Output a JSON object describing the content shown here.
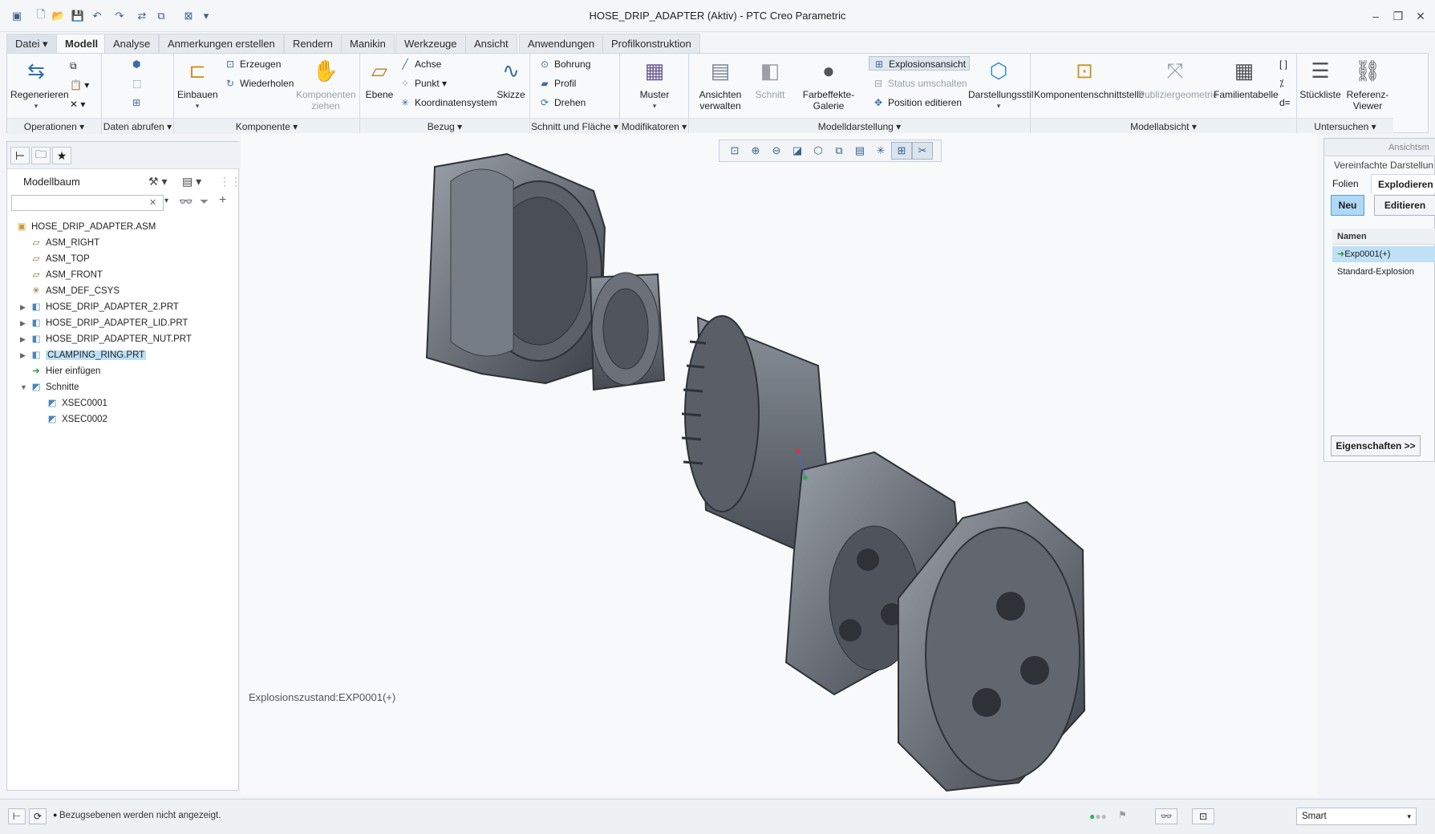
{
  "window": {
    "title": "HOSE_DRIP_ADAPTER (Aktiv) - PTC Creo Parametric"
  },
  "quick_access": {
    "icons": [
      "app-icon",
      "new-icon",
      "open-icon",
      "save-icon",
      "undo-icon",
      "redo-icon",
      "regenerate-icon",
      "windows-icon",
      "close-window-icon",
      "customize-icon"
    ]
  },
  "tabs": [
    "Datei",
    "Modell",
    "Analyse",
    "Anmerkungen erstellen",
    "Rendern",
    "Manikin",
    "Werkzeuge",
    "Ansicht",
    "Anwendungen",
    "Profilkonstruktion"
  ],
  "ribbon": {
    "operationen": {
      "regenerieren": "Regenerieren",
      "group": "Operationen"
    },
    "daten_abrufen": {
      "group": "Daten abrufen"
    },
    "komponente": {
      "einbauen": "Einbauen",
      "erzeugen": "Erzeugen",
      "wiederholen": "Wiederholen",
      "komponenten_ziehen": "Komponenten ziehen",
      "group": "Komponente"
    },
    "bezug": {
      "ebene": "Ebene",
      "achse": "Achse",
      "punkt": "Punkt",
      "koordinatensystem": "Koordinatensystem",
      "skizze": "Skizze",
      "group": "Bezug"
    },
    "schnitt": {
      "bohrung": "Bohrung",
      "profil": "Profil",
      "drehen": "Drehen",
      "group": "Schnitt und Fläche"
    },
    "modifikatoren": {
      "muster": "Muster",
      "group": "Modifikatoren"
    },
    "modelldarstellung": {
      "ansichten_verwalten": "Ansichten verwalten",
      "schnitt": "Schnitt",
      "farbeffekte": "Farbeffekte-Galerie",
      "explosionsansicht": "Explosionsansicht",
      "status_umschalten": "Status umschalten",
      "position_editieren": "Position editieren",
      "darstellungsstil": "Darstellungsstil",
      "group": "Modelldarstellung"
    },
    "modellabsicht": {
      "komponentenschnittstelle": "Komponentenschnittstelle",
      "publiziergeometrie": "Publiziergeometrie",
      "familientabelle": "Familientabelle",
      "group": "Modellabsicht"
    },
    "untersuchen": {
      "stueckliste": "Stückliste",
      "referenz_viewer": "Referenz-Viewer",
      "group": "Untersuchen"
    }
  },
  "model_tree": {
    "title": "Modellbaum",
    "search_placeholder": "",
    "items": [
      {
        "label": "HOSE_DRIP_ADAPTER.ASM",
        "icon": "assembly-icon"
      },
      {
        "label": "ASM_RIGHT",
        "icon": "datum-plane-icon"
      },
      {
        "label": "ASM_TOP",
        "icon": "datum-plane-icon"
      },
      {
        "label": "ASM_FRONT",
        "icon": "datum-plane-icon"
      },
      {
        "label": "ASM_DEF_CSYS",
        "icon": "csys-icon"
      },
      {
        "label": "HOSE_DRIP_ADAPTER_2.PRT",
        "icon": "part-icon"
      },
      {
        "label": "HOSE_DRIP_ADAPTER_LID.PRT",
        "icon": "part-icon"
      },
      {
        "label": "HOSE_DRIP_ADAPTER_NUT.PRT",
        "icon": "part-icon"
      },
      {
        "label": "CLAMPING_RING.PRT",
        "icon": "part-icon"
      },
      {
        "label": "Hier einfügen",
        "icon": "insert-arrow-icon"
      },
      {
        "label": "Schnitte",
        "icon": "sections-icon"
      },
      {
        "label": "XSEC0001",
        "icon": "section-icon"
      },
      {
        "label": "XSEC0002",
        "icon": "section-icon"
      }
    ]
  },
  "viewport": {
    "explosion_state": "Explosionszustand:EXP0001(+)"
  },
  "view_manager": {
    "header": "Ansichtsm",
    "subheader": "Vereinfachte Darstellun",
    "tabs": [
      "Folien",
      "Explodieren"
    ],
    "buttons": {
      "neu": "Neu",
      "editieren": "Editieren",
      "eigenschaften": "Eigenschaften >>"
    },
    "list_header": "Namen",
    "entries": [
      "Exp0001(+)",
      "Standard-Explosion"
    ]
  },
  "status_bar": {
    "message": "Bezugsebenen werden nicht angezeigt.",
    "filter": "Smart"
  },
  "colors": {
    "accent": "#3f6c9e",
    "selection": "#bfe0f6",
    "part_gray": "#6b7079"
  }
}
